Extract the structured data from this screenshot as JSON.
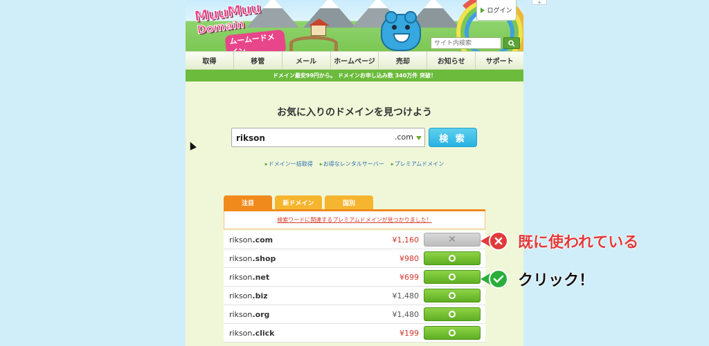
{
  "logo": {
    "line1": "MuuMuu",
    "line2": "Domain",
    "kana": "ムームードメイン"
  },
  "header": {
    "login_label": "ログイン",
    "search_placeholder": "サイト内検索"
  },
  "nav": {
    "items": [
      "取得",
      "移管",
      "メール",
      "ホームページ",
      "売却",
      "お知らせ",
      "サポート"
    ]
  },
  "banner": {
    "text": "ドメイン最安99円から。 ドメインお申し込み数 340万件 突破！"
  },
  "main": {
    "headline": "お気に入りのドメインを見つけよう",
    "search_value": "rikson",
    "tld_selected": ".com",
    "search_button": "検 索",
    "links": [
      "ドメイン一括取得",
      "お得なレンタルサーバー",
      "プレミアムドメイン"
    ]
  },
  "tabs": [
    "注目",
    "新ドメイン",
    "国別"
  ],
  "notice": "検索ワードに関連するプレミアムドメインが見つかりました！",
  "results": [
    {
      "name": "rikson",
      "tld": ".com",
      "price": "¥1,160",
      "price_color": "red",
      "status": "taken"
    },
    {
      "name": "rikson",
      "tld": ".shop",
      "price": "¥980",
      "price_color": "red",
      "status": "available"
    },
    {
      "name": "rikson",
      "tld": ".net",
      "price": "¥699",
      "price_color": "red",
      "status": "available"
    },
    {
      "name": "rikson",
      "tld": ".biz",
      "price": "¥1,480",
      "price_color": "gray",
      "status": "available"
    },
    {
      "name": "rikson",
      "tld": ".org",
      "price": "¥1,480",
      "price_color": "gray",
      "status": "available"
    },
    {
      "name": "rikson",
      "tld": ".click",
      "price": "¥199",
      "price_color": "red",
      "status": "available"
    }
  ],
  "annotations": {
    "taken": "既に使われている",
    "click": "クリック！"
  },
  "icons": {
    "taken": "x-icon",
    "available": "circle-icon",
    "check": "check-icon"
  },
  "colors": {
    "accent_green": "#6cbb3c",
    "accent_orange": "#f08a1c",
    "search_blue": "#28b2e2",
    "red": "#e23a3a"
  }
}
